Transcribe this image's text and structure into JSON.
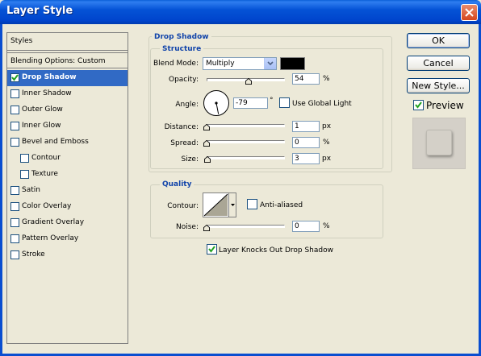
{
  "window": {
    "title": "Layer Style"
  },
  "styles_panel": {
    "header": "Styles",
    "blending_options": "Blending Options: Custom",
    "items": [
      {
        "label": "Drop Shadow",
        "checked": true,
        "selected": true,
        "indent": false
      },
      {
        "label": "Inner Shadow",
        "checked": false,
        "selected": false,
        "indent": false
      },
      {
        "label": "Outer Glow",
        "checked": false,
        "selected": false,
        "indent": false
      },
      {
        "label": "Inner Glow",
        "checked": false,
        "selected": false,
        "indent": false
      },
      {
        "label": "Bevel and Emboss",
        "checked": false,
        "selected": false,
        "indent": false
      },
      {
        "label": "Contour",
        "checked": false,
        "selected": false,
        "indent": true
      },
      {
        "label": "Texture",
        "checked": false,
        "selected": false,
        "indent": true
      },
      {
        "label": "Satin",
        "checked": false,
        "selected": false,
        "indent": false
      },
      {
        "label": "Color Overlay",
        "checked": false,
        "selected": false,
        "indent": false
      },
      {
        "label": "Gradient Overlay",
        "checked": false,
        "selected": false,
        "indent": false
      },
      {
        "label": "Pattern Overlay",
        "checked": false,
        "selected": false,
        "indent": false
      },
      {
        "label": "Stroke",
        "checked": false,
        "selected": false,
        "indent": false
      }
    ]
  },
  "drop_shadow": {
    "title": "Drop Shadow",
    "structure_title": "Structure",
    "blend_mode_label": "Blend Mode:",
    "blend_mode_value": "Multiply",
    "shadow_color": "#000000",
    "opacity_label": "Opacity:",
    "opacity_value": "54",
    "opacity_unit": "%",
    "opacity_fraction": 0.54,
    "angle_label": "Angle:",
    "angle_value": "-79",
    "angle_unit": "°",
    "angle_degrees": -79,
    "use_global_light_label": "Use Global Light",
    "use_global_light_checked": false,
    "distance_label": "Distance:",
    "distance_value": "1",
    "distance_unit": "px",
    "spread_label": "Spread:",
    "spread_value": "0",
    "spread_unit": "%",
    "size_label": "Size:",
    "size_value": "3",
    "size_unit": "px"
  },
  "quality": {
    "title": "Quality",
    "contour_label": "Contour:",
    "anti_aliased_label": "Anti-aliased",
    "anti_aliased_checked": false,
    "noise_label": "Noise:",
    "noise_value": "0",
    "noise_unit": "%"
  },
  "knockout": {
    "label": "Layer Knocks Out Drop Shadow",
    "checked": true
  },
  "buttons": {
    "ok": "OK",
    "cancel": "Cancel",
    "new_style": "New Style..."
  },
  "preview": {
    "label": "Preview",
    "checked": true
  },
  "colors": {
    "accent_blue": "#316ac5",
    "group_title": "#1144aa",
    "titlebar": "#0553d6"
  }
}
